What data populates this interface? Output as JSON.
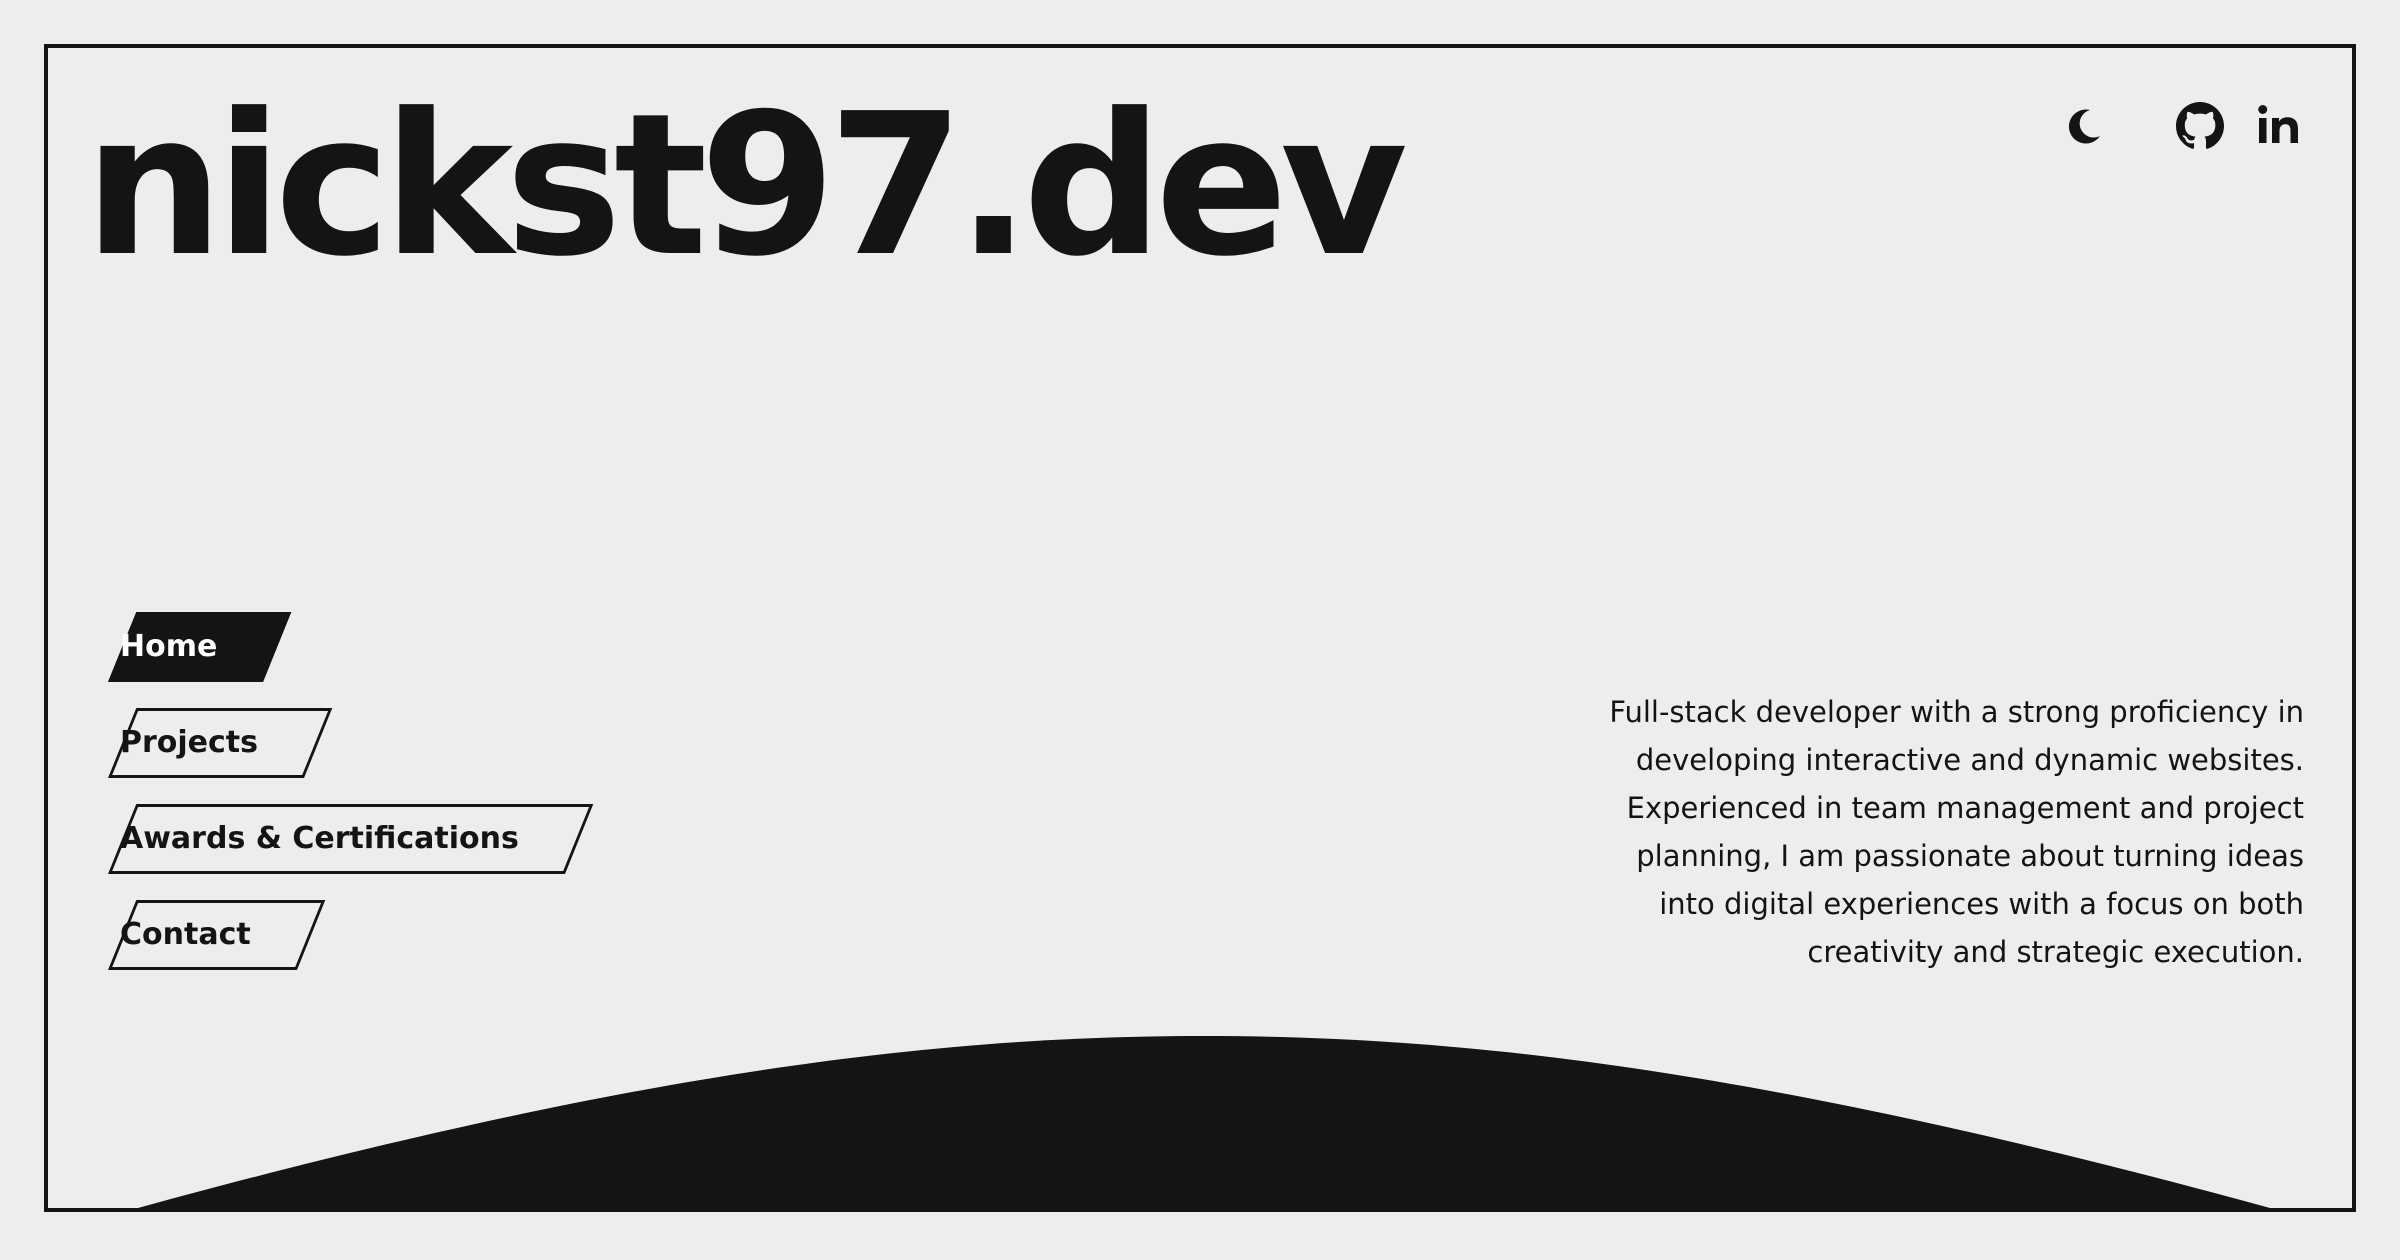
{
  "header": {
    "site_title": "nickst97.dev"
  },
  "icons": {
    "theme_toggle": "moon-icon",
    "github": "github-icon",
    "linkedin": "linkedin-icon"
  },
  "nav": {
    "items": [
      {
        "label": "Home",
        "active": true
      },
      {
        "label": "Projects",
        "active": false
      },
      {
        "label": "Awards & Certifications",
        "active": false
      },
      {
        "label": "Contact",
        "active": false
      }
    ]
  },
  "bio": {
    "text": "Full-stack developer with a strong proficiency in developing interactive and dynamic websites. Experienced in team management and project planning, I am passionate about turning ideas into digital experiences with a focus on both creativity and strategic execution."
  },
  "colors": {
    "background": "#ededed",
    "foreground": "#141414"
  }
}
